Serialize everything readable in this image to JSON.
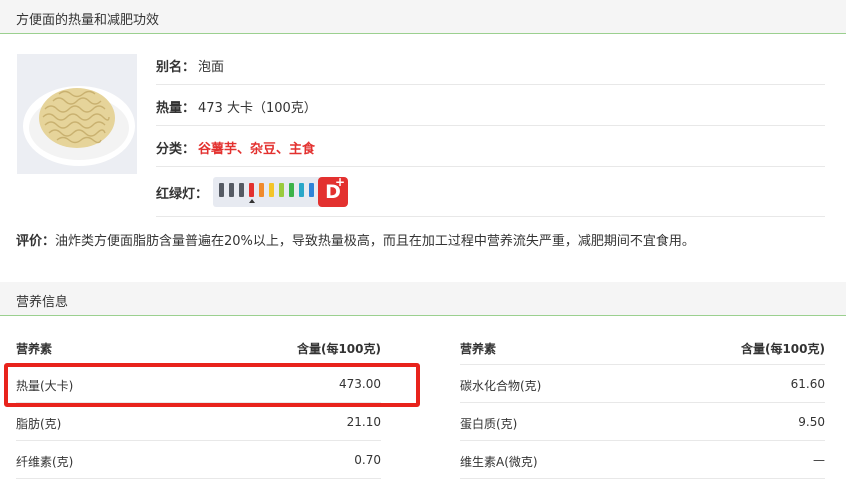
{
  "section_food": {
    "title": "方便面的热量和减肥功效"
  },
  "food": {
    "image_label": "noodles-photo",
    "alias_label": "别名：",
    "alias": "泡面",
    "heat_label": "热量：",
    "heat": "473 大卡（100克）",
    "category_label": "分类：",
    "category": "谷薯芋、杂豆、主食",
    "traffic_light_label": "红绿灯：",
    "traffic_light_grade": "D",
    "traffic_light_grade_plus": "+",
    "traffic_light_colors": [
      "#555a63",
      "#555a63",
      "#555a63",
      "#e3312f",
      "#f08a2c",
      "#f3c528",
      "#9bcb3c",
      "#3cb34a",
      "#2aa7c9",
      "#2f83d8"
    ],
    "evaluation_label": "评价：",
    "evaluation": "油炸类方便面脂肪含量普遍在20%以上，导致热量极高，而且在加工过程中营养流失严重，减肥期间不宜食用。"
  },
  "section_nutrition": {
    "title": "营养信息"
  },
  "nutrition": {
    "header_name": "营养素",
    "header_amount": "含量(每100克)",
    "left": [
      {
        "name": "热量(大卡)",
        "amount": "473.00"
      },
      {
        "name": "脂肪(克)",
        "amount": "21.10"
      },
      {
        "name": "纤维素(克)",
        "amount": "0.70"
      }
    ],
    "right": [
      {
        "name": "碳水化合物(克)",
        "amount": "61.60"
      },
      {
        "name": "蛋白质(克)",
        "amount": "9.50"
      },
      {
        "name": "维生素A(微克)",
        "amount": "—"
      }
    ]
  },
  "colors": {
    "accent_green": "#9bd08f",
    "red": "#e3312f",
    "highlight": "#e8231c"
  }
}
